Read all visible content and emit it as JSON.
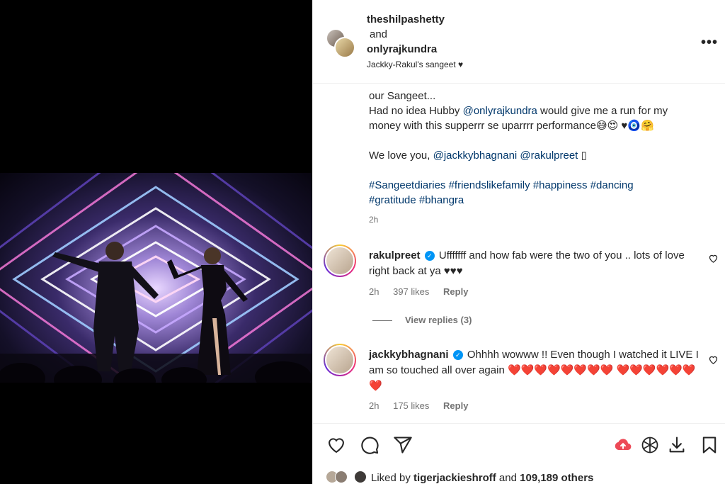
{
  "post": {
    "user1": "theshilpashetty",
    "and_label": "and",
    "user2": "onlyrajkundra",
    "subtitle": "Jackky-Rakul's sangeet ♥",
    "more_label": "•••"
  },
  "caption": {
    "line1": "our Sangeet...",
    "line2_pre": "Had no idea Hubby ",
    "line2_mention": "@onlyrajkundra",
    "line2_post": " would give me a run for my money with this supperrr se uparrrr performance😅😍 ♥🧿🤗",
    "line3_pre": "We love you, ",
    "line3_m1": "@jackkybhagnani",
    "line3_m2": "@rakulpreet",
    "line3_post": " ▯",
    "hashtags1": "#Sangeetdiaries #friendslikefamily #happiness #dancing",
    "hashtags2": "#gratitude #bhangra",
    "time": "2h"
  },
  "comments": [
    {
      "user": "rakulpreet",
      "text": "Ufffffff and how fab were the two of you .. lots of love right back at ya ♥♥♥",
      "time": "2h",
      "likes": "397 likes",
      "reply": "Reply",
      "view_replies": "View replies (3)"
    },
    {
      "user": "jackkybhagnani",
      "text": "Ohhhh wowww !! Even though I watched it LIVE I am so touched all over again ❤️❤️❤️❤️❤️❤️❤️❤️ ❤️❤️❤️❤️❤️❤️❤️",
      "time": "2h",
      "likes": "175 likes",
      "reply": "Reply"
    }
  ],
  "liked_by": {
    "prefix": "Liked by ",
    "user": "tigerjackieshroff",
    "middle": " and ",
    "count": "109,189 others"
  },
  "colors": {
    "mention": "#00376b",
    "verified": "#0095f6",
    "meta_gray": "#737373",
    "save_to_cloud": "#ed4956"
  },
  "icons": [
    "heart-icon",
    "comment-icon",
    "share-icon",
    "cloud-upload-icon",
    "openai-icon",
    "download-icon",
    "bookmark-icon"
  ]
}
